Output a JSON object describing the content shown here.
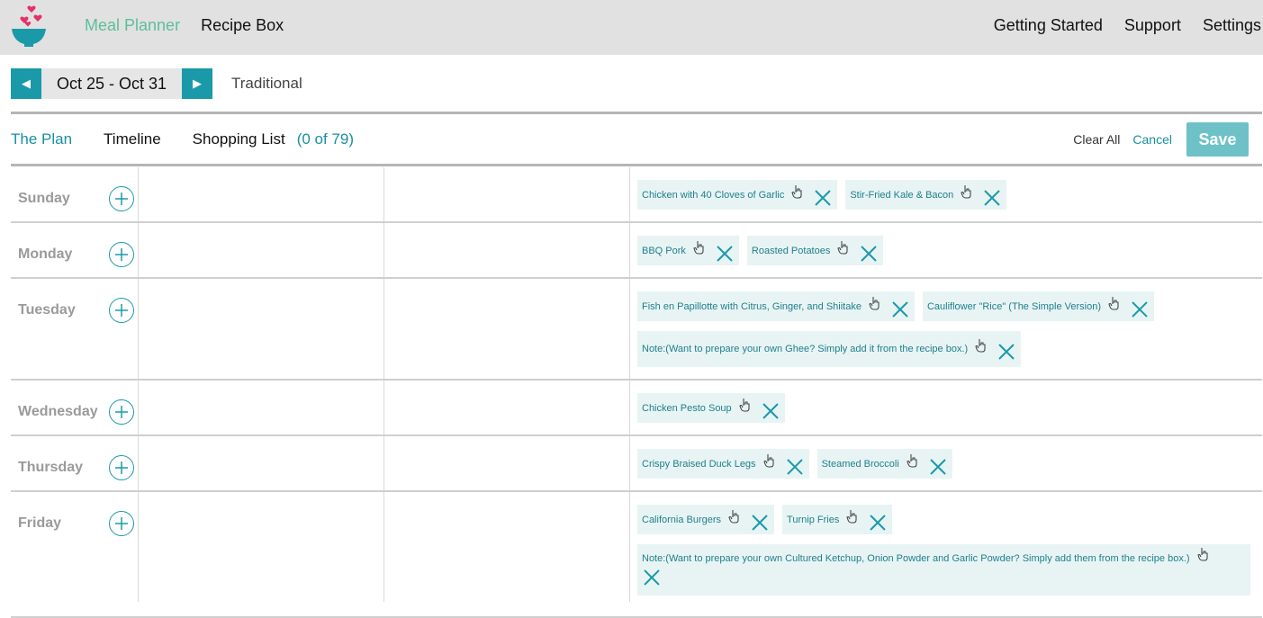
{
  "nav": {
    "left": [
      {
        "label": "Meal Planner",
        "active": true
      },
      {
        "label": "Recipe Box",
        "active": false
      }
    ],
    "right": [
      {
        "label": "Getting Started"
      },
      {
        "label": "Support"
      },
      {
        "label": "Settings"
      }
    ]
  },
  "week": {
    "range": "Oct 25 - Oct 31",
    "plan_type": "Traditional"
  },
  "tabs": {
    "plan": "The Plan",
    "timeline": "Timeline",
    "shopping": "Shopping List",
    "shopping_count": "(0 of 79)"
  },
  "actions": {
    "clear_all": "Clear All",
    "cancel": "Cancel",
    "save": "Save"
  },
  "colors": {
    "accent": "#1a9aa9",
    "nav_active": "#5cbf9a",
    "save_bg": "#6fc1c8",
    "chip_bg": "#e8f4f4"
  },
  "days": [
    {
      "name": "Sunday",
      "meals": [
        "Chicken with 40 Cloves of Garlic",
        "Stir-Fried Kale & Bacon"
      ]
    },
    {
      "name": "Monday",
      "meals": [
        "BBQ Pork",
        "Roasted Potatoes"
      ]
    },
    {
      "name": "Tuesday",
      "meals": [
        "Fish en Papillotte with Citrus, Ginger, and Shiitake",
        "Cauliflower \"Rice\" (The Simple Version)",
        "Note:(Want to prepare your own Ghee? Simply add it from the recipe box.)"
      ]
    },
    {
      "name": "Wednesday",
      "meals": [
        "Chicken Pesto Soup"
      ]
    },
    {
      "name": "Thursday",
      "meals": [
        "Crispy Braised Duck Legs",
        "Steamed Broccoli"
      ]
    },
    {
      "name": "Friday",
      "meals": [
        "California Burgers",
        "Turnip Fries",
        "Note:(Want to prepare your own Cultured Ketchup, Onion Powder and Garlic Powder? Simply add them from the recipe box.)"
      ]
    }
  ]
}
